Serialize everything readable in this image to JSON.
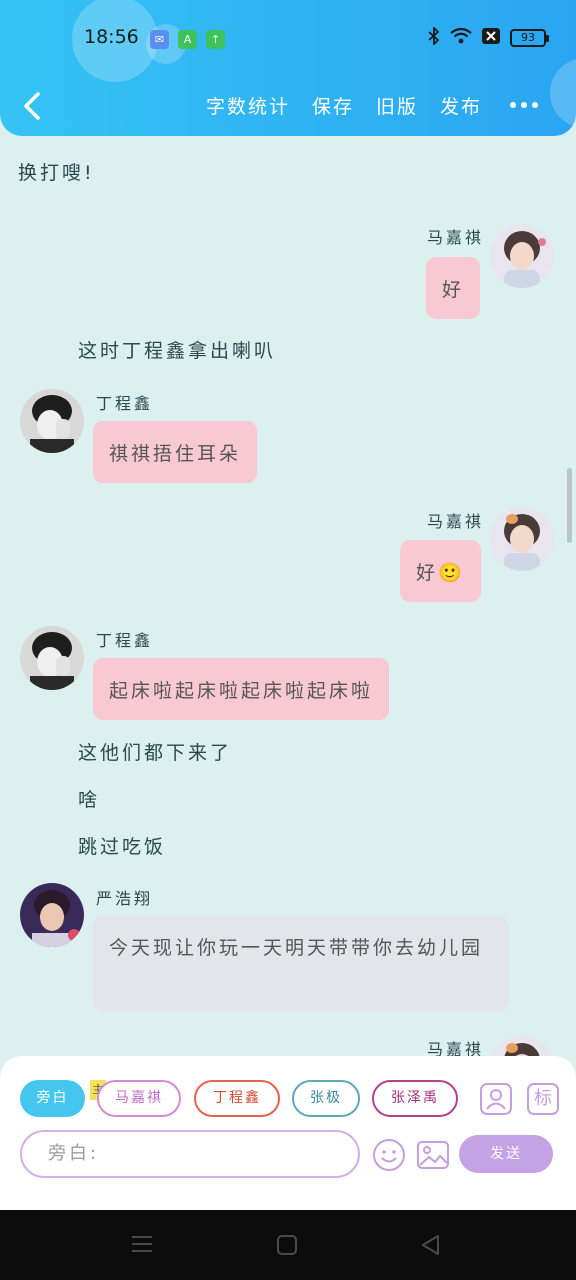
{
  "status_bar": {
    "time": "18:56",
    "battery": "93"
  },
  "header": {
    "nav_items": [
      "字数统计",
      "保存",
      "旧版",
      "发布"
    ]
  },
  "chat": {
    "narration_top": "换打嗖!",
    "messages": [
      {
        "speaker": "马嘉祺",
        "text": "好"
      },
      {
        "narration": "这时丁程鑫拿出喇叭"
      },
      {
        "speaker": "丁程鑫",
        "text": "祺祺捂住耳朵"
      },
      {
        "speaker": "马嘉祺",
        "text": "好🙂"
      },
      {
        "speaker": "丁程鑫",
        "text": "起床啦起床啦起床啦起床啦"
      },
      {
        "narration": "这他们都下来了"
      },
      {
        "narration": "啥"
      },
      {
        "narration": "跳过吃饭"
      },
      {
        "speaker": "严浩翔",
        "text": "今天现让你玩一天明天带带你去幼儿园"
      },
      {
        "speaker": "马嘉祺",
        "text": ""
      }
    ]
  },
  "panel": {
    "roles": [
      "旁白",
      "马嘉祺",
      "丁程鑫",
      "张极",
      "张泽禹"
    ],
    "host_tag": "主",
    "tool_tag": "标",
    "input_placeholder": "旁白:",
    "send_label": "发送"
  },
  "colors": {
    "header_gradient_start": "#35c3f4",
    "header_gradient_end": "#2aa5f2",
    "background": "#dcf0ef",
    "pink_bubble": "#f9c9d3",
    "grey_bubble": "#e4e5ea",
    "active_role": "#45c6ee",
    "send_button": "#c4a2e3"
  }
}
